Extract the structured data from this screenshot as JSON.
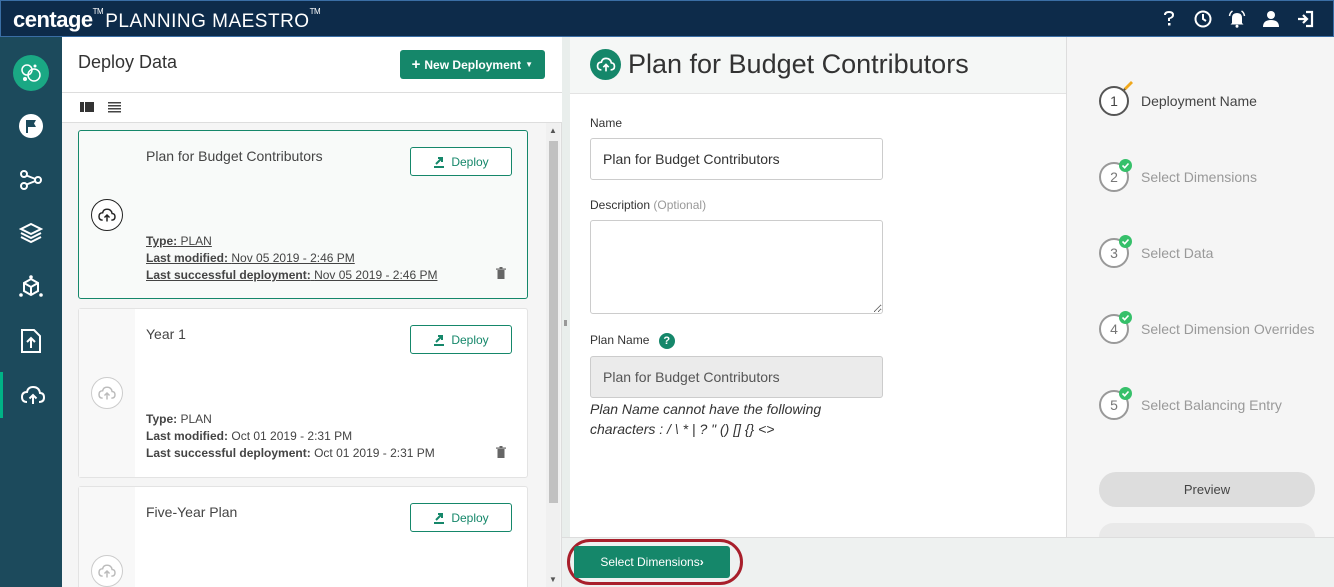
{
  "app": {
    "brand": "centage",
    "brand_mark": "TM",
    "product": "PLANNING MAESTRO",
    "product_mark": "TM"
  },
  "topbar": {
    "icons": [
      "help-icon",
      "clock-icon",
      "alarm-icon",
      "user-icon",
      "logout-icon"
    ]
  },
  "leftnav": {
    "items": [
      "flag-icon",
      "share-icon",
      "layers-icon",
      "cube-icon",
      "upload-icon",
      "cloud-upload-icon"
    ],
    "active": "cloud-upload-icon"
  },
  "list": {
    "title": "Deploy Data",
    "new_button": "New Deployment",
    "deploy_label": "Deploy",
    "type_label": "Type:",
    "modified_label": "Last modified:",
    "success_label": "Last successful deployment:",
    "cards": [
      {
        "title": "Plan for Budget Contributors",
        "type": "PLAN",
        "modified": "Nov 05 2019 - 2:46 PM",
        "success": "Nov 05 2019 - 2:46 PM"
      },
      {
        "title": "Year 1",
        "type": "PLAN",
        "modified": "Oct 01 2019 - 2:31 PM",
        "success": "Oct 01 2019 - 2:31 PM"
      },
      {
        "title": "Five-Year Plan"
      }
    ]
  },
  "form": {
    "title": "Plan for Budget Contributors",
    "name_label": "Name",
    "name_value": "Plan for Budget Contributors",
    "description_label": "Description",
    "description_optional": "(Optional)",
    "description_value": "",
    "plan_name_label": "Plan Name",
    "plan_name_help": "?",
    "plan_name_value": "Plan for Budget Contributors",
    "hint_line1": "Plan Name cannot have the following",
    "hint_line2": "characters : / \\ * | ? \" () [] {} <>"
  },
  "steps": {
    "items": [
      {
        "num": "1",
        "label": "Deployment Name"
      },
      {
        "num": "2",
        "label": "Select Dimensions"
      },
      {
        "num": "3",
        "label": "Select Data"
      },
      {
        "num": "4",
        "label": "Select Dimension Overrides"
      },
      {
        "num": "5",
        "label": "Select Balancing Entry"
      }
    ],
    "preview": "Preview"
  },
  "footer": {
    "next_button": "Select Dimensions"
  },
  "colors": {
    "brand_green": "#15876a",
    "topbar": "#0d2b4a",
    "nav": "#1c4a5c",
    "highlight": "#a81f2b"
  }
}
